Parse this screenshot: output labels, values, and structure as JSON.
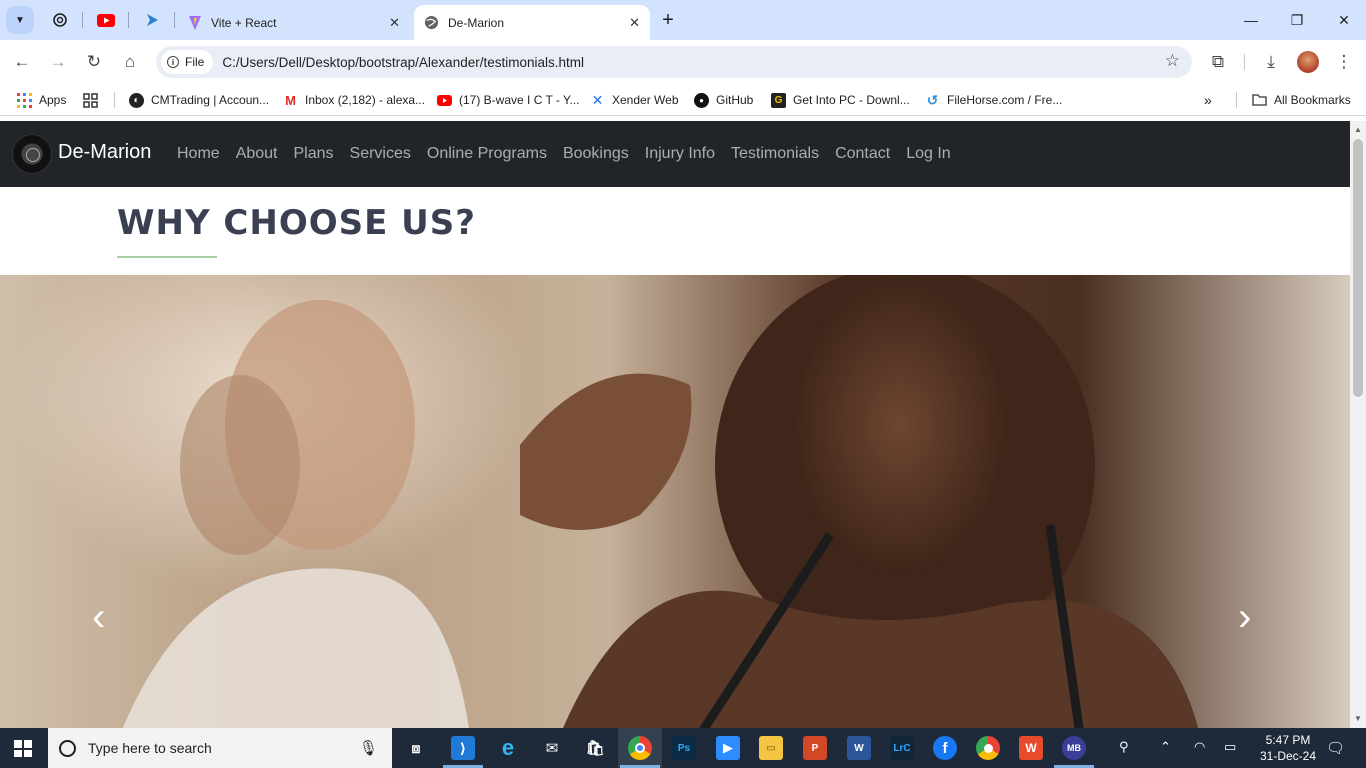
{
  "browser": {
    "tabs": [
      {
        "title": "Vite + React",
        "active": false
      },
      {
        "title": "De-Marion",
        "active": true
      }
    ],
    "address": {
      "chip_label": "File",
      "url": "C:/Users/Dell/Desktop/bootstrap/Alexander/testimonials.html"
    },
    "bookmarks": [
      {
        "label": "Apps",
        "icon": "apps-grid-icon"
      },
      {
        "label": "CMTrading | Accoun...",
        "icon": "cmtrading-icon"
      },
      {
        "label": "Inbox (2,182) - alexa...",
        "icon": "gmail-icon"
      },
      {
        "label": "(17) B-wave I C T - Y...",
        "icon": "youtube-icon"
      },
      {
        "label": "Xender Web",
        "icon": "xender-icon"
      },
      {
        "label": "GitHub",
        "icon": "github-icon"
      },
      {
        "label": "Get Into PC - Downl...",
        "icon": "getintopc-icon"
      },
      {
        "label": "FileHorse.com / Fre...",
        "icon": "filehorse-icon"
      }
    ],
    "all_bookmarks": "All Bookmarks"
  },
  "site": {
    "brand": "De-Marion",
    "nav": [
      "Home",
      "About",
      "Plans",
      "Services",
      "Online Programs",
      "Bookings",
      "Injury Info",
      "Testimonials",
      "Contact",
      "Log In"
    ],
    "section_title": "WHY CHOOSE US?"
  },
  "taskbar": {
    "search_placeholder": "Type here to search",
    "time": "5:47 PM",
    "date": "31-Dec-24"
  },
  "colors": {
    "navbar_bg": "#212529",
    "title_color": "#3a3f51",
    "underline_color": "#a9cfa7",
    "tabstrip_bg": "#d3e3fd"
  }
}
